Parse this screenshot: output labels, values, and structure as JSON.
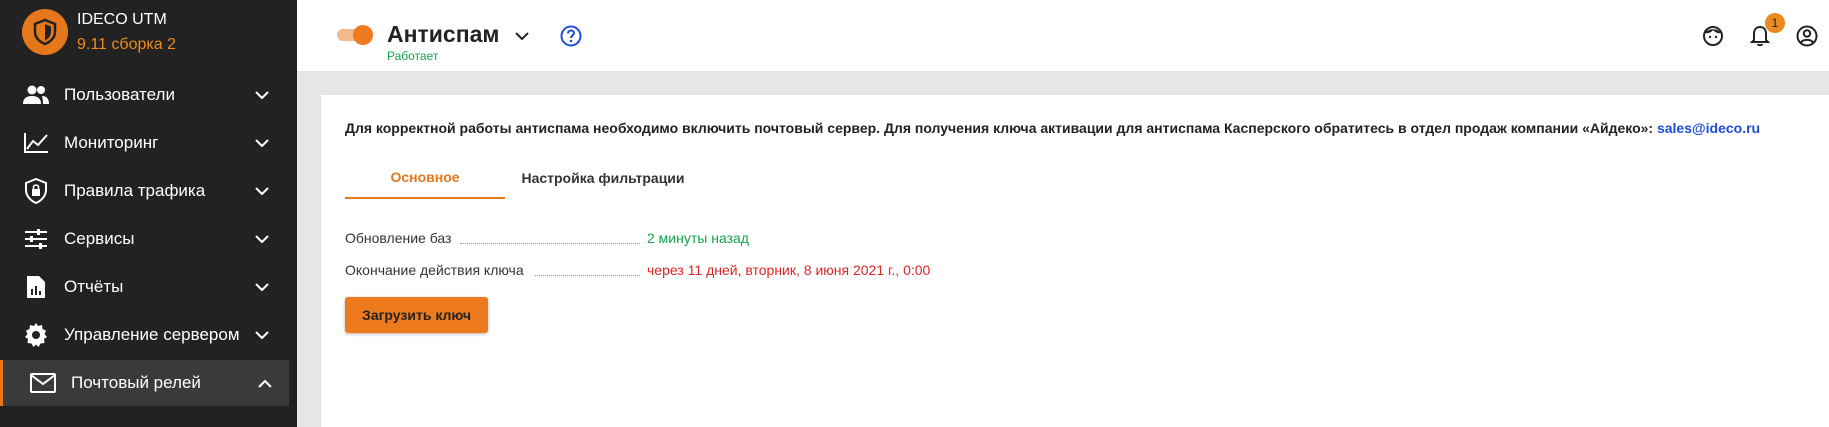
{
  "brand": {
    "name": "IDECO UTM",
    "version": "9.11 сборка 2"
  },
  "sidebar": {
    "items": [
      {
        "label": "Пользователи",
        "icon": "users-icon"
      },
      {
        "label": "Мониторинг",
        "icon": "chart-line-icon"
      },
      {
        "label": "Правила трафика",
        "icon": "shield-lock-icon"
      },
      {
        "label": "Сервисы",
        "icon": "sliders-icon"
      },
      {
        "label": "Отчёты",
        "icon": "report-icon"
      },
      {
        "label": "Управление сервером",
        "icon": "gear-icon"
      },
      {
        "label": "Почтовый релей",
        "icon": "mail-icon",
        "active": true
      }
    ]
  },
  "header": {
    "title": "Антиспам",
    "status": "Работает",
    "enabled": true,
    "notifications_count": "1"
  },
  "main": {
    "info_text": "Для корректной работы антиспама необходимо включить почтовый сервер. Для получения ключа активации для антиспама Касперского обратитесь в отдел продаж компании «Айдеко»: ",
    "info_link": "sales@ideco.ru",
    "tabs": [
      {
        "label": "Основное",
        "active": true
      },
      {
        "label": "Настройка фильтрации",
        "active": false
      }
    ],
    "details": [
      {
        "key": "Обновление баз",
        "value": "2 минуты назад",
        "color": "#16a34a"
      },
      {
        "key": "Окончание действия ключа",
        "value": "через 11 дней, вторник, 8 июня 2021 г., 0:00",
        "color": "#dc2626"
      }
    ],
    "upload_button": "Загрузить ключ"
  },
  "colors": {
    "accent": "#e7771b",
    "sidebar_bg": "#222222",
    "success": "#16a34a",
    "danger": "#dc2626",
    "link": "#1d4ed8"
  }
}
